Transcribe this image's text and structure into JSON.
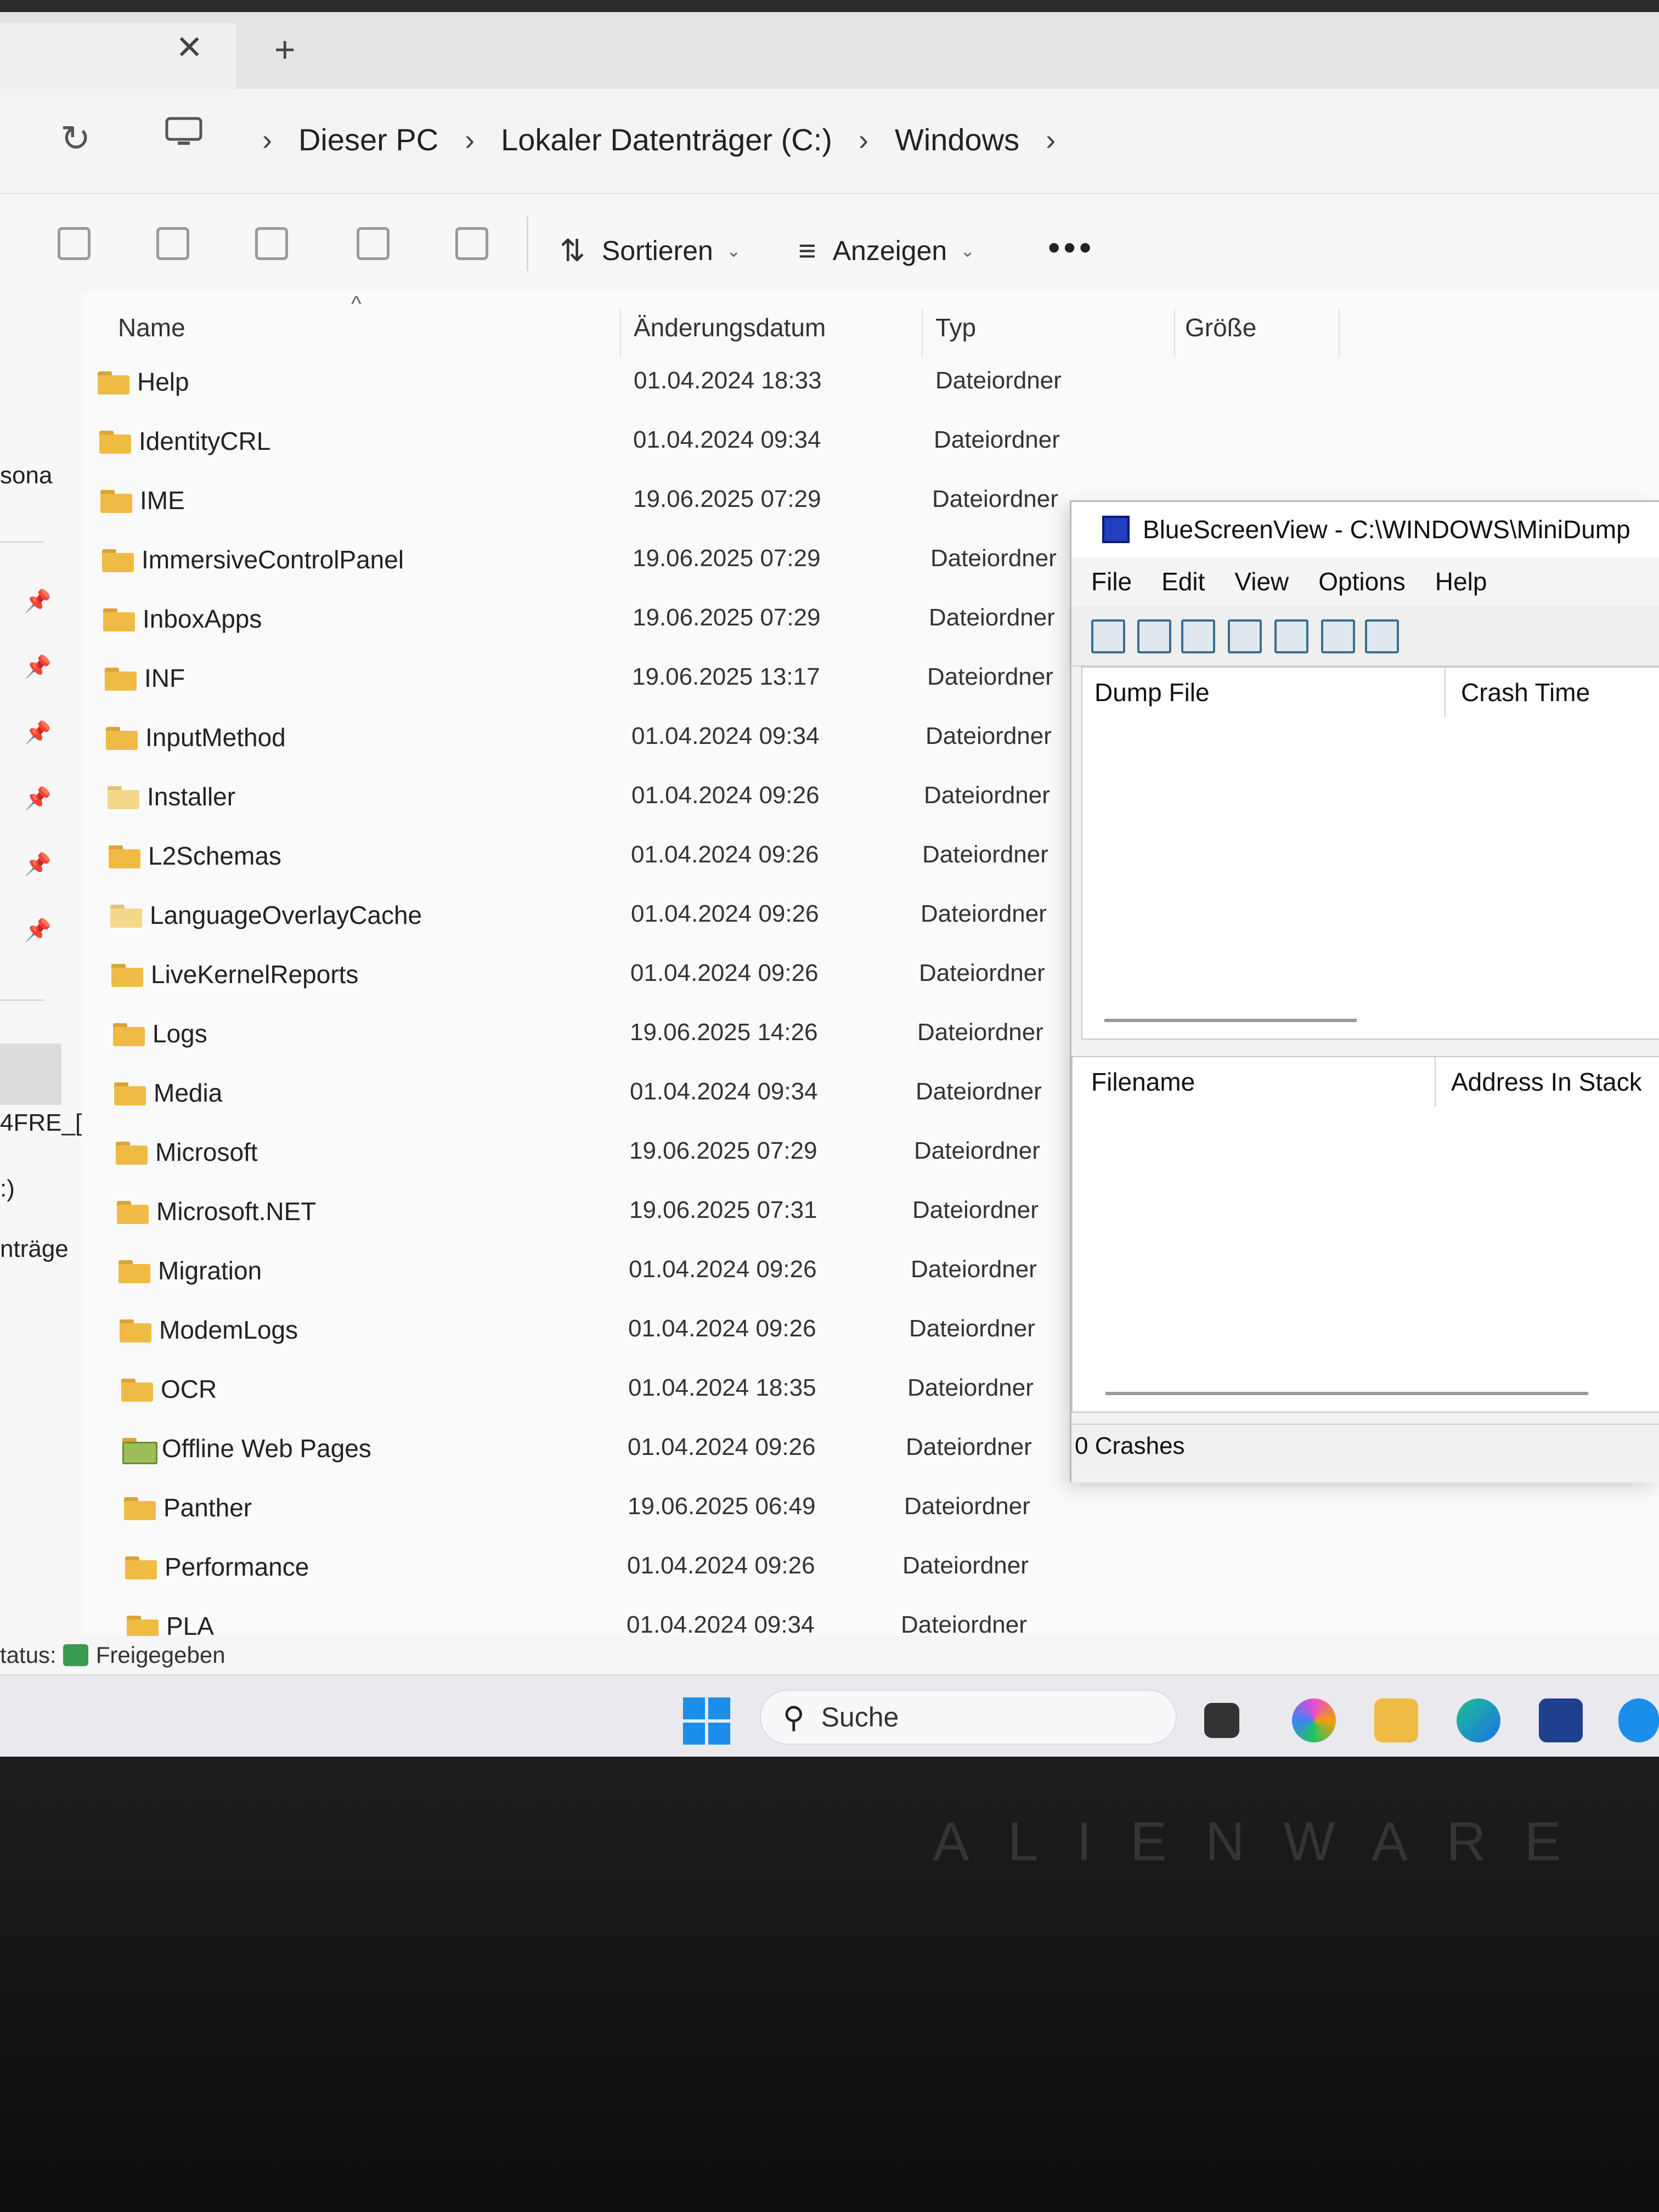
{
  "tab": {
    "close_glyph": "✕",
    "new_glyph": "+"
  },
  "address": {
    "refresh_icon": "refresh-icon",
    "crumbs": [
      "Dieser PC",
      "Lokaler Datenträger (C:)",
      "Windows"
    ]
  },
  "commandbar": {
    "sort_label": "Sortieren",
    "view_label": "Anzeigen",
    "more_label": "•••"
  },
  "nav": {
    "labels": [
      "sona",
      "4FRE_[",
      ":)",
      "nträge"
    ]
  },
  "columns": {
    "name": "Name",
    "date": "Änderungsdatum",
    "type": "Typ",
    "size": "Größe"
  },
  "files": [
    {
      "name": "Help",
      "date": "01.04.2024 18:33",
      "type": "Dateiordner"
    },
    {
      "name": "IdentityCRL",
      "date": "01.04.2024 09:34",
      "type": "Dateiordner"
    },
    {
      "name": "IME",
      "date": "19.06.2025 07:29",
      "type": "Dateiordner"
    },
    {
      "name": "ImmersiveControlPanel",
      "date": "19.06.2025 07:29",
      "type": "Dateiordner"
    },
    {
      "name": "InboxApps",
      "date": "19.06.2025 07:29",
      "type": "Dateiordner"
    },
    {
      "name": "INF",
      "date": "19.06.2025 13:17",
      "type": "Dateiordner"
    },
    {
      "name": "InputMethod",
      "date": "01.04.2024 09:34",
      "type": "Dateiordner"
    },
    {
      "name": "Installer",
      "date": "01.04.2024 09:26",
      "type": "Dateiordner"
    },
    {
      "name": "L2Schemas",
      "date": "01.04.2024 09:26",
      "type": "Dateiordner"
    },
    {
      "name": "LanguageOverlayCache",
      "date": "01.04.2024 09:26",
      "type": "Dateiordner"
    },
    {
      "name": "LiveKernelReports",
      "date": "01.04.2024 09:26",
      "type": "Dateiordner"
    },
    {
      "name": "Logs",
      "date": "19.06.2025 14:26",
      "type": "Dateiordner"
    },
    {
      "name": "Media",
      "date": "01.04.2024 09:34",
      "type": "Dateiordner"
    },
    {
      "name": "Microsoft",
      "date": "19.06.2025 07:29",
      "type": "Dateiordner"
    },
    {
      "name": "Microsoft.NET",
      "date": "19.06.2025 07:31",
      "type": "Dateiordner"
    },
    {
      "name": "Migration",
      "date": "01.04.2024 09:26",
      "type": "Dateiordner"
    },
    {
      "name": "ModemLogs",
      "date": "01.04.2024 09:26",
      "type": "Dateiordner"
    },
    {
      "name": "OCR",
      "date": "01.04.2024 18:35",
      "type": "Dateiordner"
    },
    {
      "name": "Offline Web Pages",
      "date": "01.04.2024 09:26",
      "type": "Dateiordner"
    },
    {
      "name": "Panther",
      "date": "19.06.2025 06:49",
      "type": "Dateiordner"
    },
    {
      "name": "Performance",
      "date": "01.04.2024 09:26",
      "type": "Dateiordner"
    },
    {
      "name": "PLA",
      "date": "01.04.2024 09:34",
      "type": "Dateiordner"
    }
  ],
  "status": {
    "label": "tatus:",
    "value": "Freigegeben"
  },
  "taskbar": {
    "search_placeholder": "Suche"
  },
  "bluescreenview": {
    "title": "BlueScreenView  -  C:\\WINDOWS\\MiniDump",
    "menu": [
      "File",
      "Edit",
      "View",
      "Options",
      "Help"
    ],
    "upper_columns": [
      "Dump File",
      "Crash Time"
    ],
    "lower_columns": [
      "Filename",
      "Address In Stack"
    ],
    "status": "0 Crashes"
  },
  "brand": "ALIENWARE",
  "colors": {
    "folder": "#f0bb45",
    "accent": "#1a8ee8",
    "bsv_icon": "#1f3fbf"
  }
}
